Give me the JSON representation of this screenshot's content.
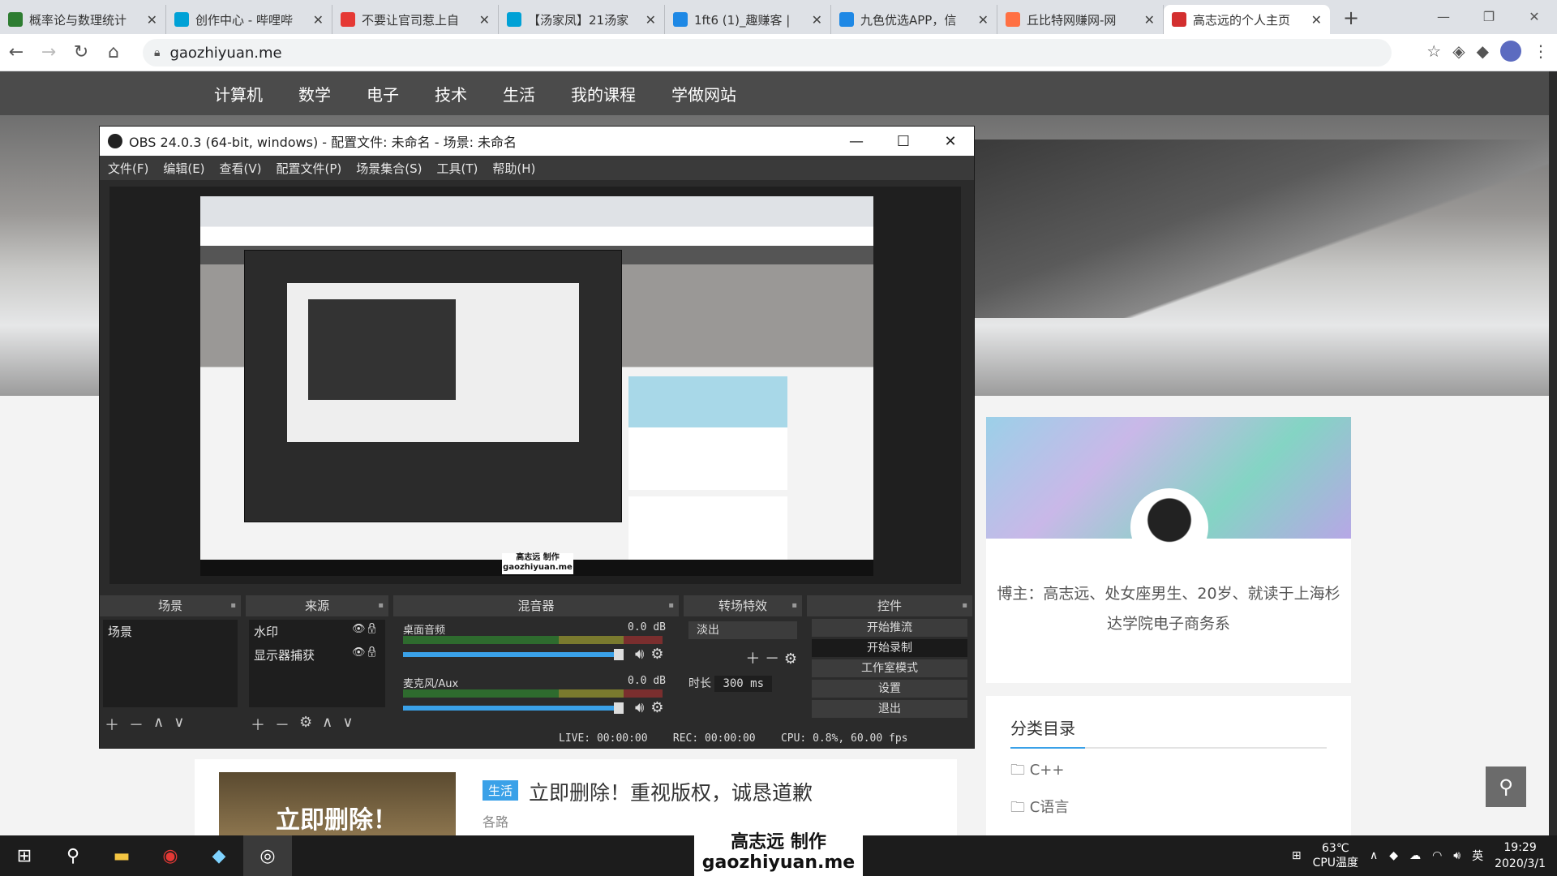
{
  "browser": {
    "tabs": [
      {
        "title": "概率论与数理统计",
        "color": "#2e7d32"
      },
      {
        "title": "创作中心 - 哔哩哔",
        "color": "#00a1d6"
      },
      {
        "title": "不要让官司惹上自",
        "color": "#e53935"
      },
      {
        "title": "【汤家凤】21汤家",
        "color": "#00a1d6"
      },
      {
        "title": "1ft6 (1)_趣赚客 |",
        "color": "#1e88e5"
      },
      {
        "title": "九色优选APP，信",
        "color": "#1e88e5"
      },
      {
        "title": "丘比特网赚网-网",
        "color": "#ff7043"
      },
      {
        "title": "高志远的个人主页",
        "color": "#d32f2f"
      }
    ],
    "url": "gaozhiyuan.me"
  },
  "site": {
    "nav": [
      "计算机",
      "数学",
      "电子",
      "技术",
      "生活",
      "我的课程",
      "学做网站"
    ],
    "bio": "博主：高志远、处女座男生、20岁、就读于上海杉达学院电子商务系",
    "category_title": "分类目录",
    "categories": [
      "C++",
      "C语言"
    ],
    "post": {
      "tag": "生活",
      "title": "立即删除！重视版权，诚恳道歉",
      "excerpt": "各路",
      "thumb_text": "立即删除！"
    }
  },
  "obs": {
    "title": "OBS 24.0.3 (64-bit, windows) - 配置文件: 未命名 - 场景: 未命名",
    "menu": [
      "文件(F)",
      "编辑(E)",
      "查看(V)",
      "配置文件(P)",
      "场景集合(S)",
      "工具(T)",
      "帮助(H)"
    ],
    "docks": {
      "scenes": {
        "title": "场景",
        "items": [
          "场景"
        ]
      },
      "sources": {
        "title": "来源",
        "items": [
          "水印",
          "显示器捕获"
        ]
      },
      "mixer": {
        "title": "混音器",
        "tracks": [
          {
            "name": "桌面音频",
            "db": "0.0 dB"
          },
          {
            "name": "麦克风/Aux",
            "db": "0.0 dB"
          }
        ]
      },
      "transitions": {
        "title": "转场特效",
        "selected": "淡出",
        "duration_label": "时长",
        "duration": "300 ms"
      },
      "controls": {
        "title": "控件",
        "buttons": [
          "开始推流",
          "开始录制",
          "工作室模式",
          "设置",
          "退出"
        ]
      }
    },
    "status": {
      "live": "LIVE: 00:00:00",
      "rec": "REC: 00:00:00",
      "cpu": "CPU: 0.8%, 60.00 fps"
    }
  },
  "watermark": {
    "line1": "高志远 制作",
    "line2": "gaozhiyuan.me"
  },
  "taskbar": {
    "temp": "63℃",
    "cpu_label": "CPU温度",
    "ime": "英",
    "time": "19:29",
    "date": "2020/3/1"
  }
}
